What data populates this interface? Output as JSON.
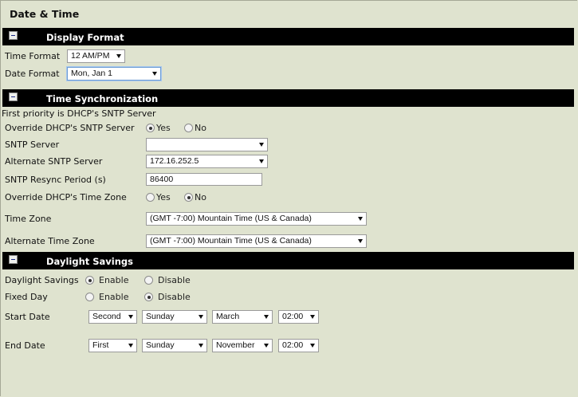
{
  "page_title": "Date & Time",
  "display_format": {
    "header": "Display Format",
    "time_format_label": "Time Format",
    "time_format_value": "12 AM/PM",
    "date_format_label": "Date Format",
    "date_format_value": "Mon, Jan 1"
  },
  "time_sync": {
    "header": "Time Synchronization",
    "note": "First priority is DHCP's SNTP Server",
    "override_sntp_label": "Override DHCP's SNTP Server",
    "override_sntp_yes": "Yes",
    "override_sntp_no": "No",
    "override_sntp_selected": "Yes",
    "sntp_server_label": "SNTP Server",
    "sntp_server_value": "",
    "alt_sntp_label": "Alternate SNTP Server",
    "alt_sntp_value": "172.16.252.5",
    "resync_label": "SNTP Resync Period (s)",
    "resync_value": "86400",
    "override_tz_label": "Override DHCP's Time Zone",
    "override_tz_yes": "Yes",
    "override_tz_no": "No",
    "override_tz_selected": "No",
    "time_zone_label": "Time Zone",
    "time_zone_value": "(GMT -7:00) Mountain Time (US & Canada)",
    "alt_time_zone_label": "Alternate Time Zone",
    "alt_time_zone_value": "(GMT -7:00) Mountain Time (US & Canada)"
  },
  "daylight": {
    "header": "Daylight Savings",
    "ds_label": "Daylight Savings",
    "ds_enable": "Enable",
    "ds_disable": "Disable",
    "ds_selected": "Enable",
    "fixed_label": "Fixed Day",
    "fixed_enable": "Enable",
    "fixed_disable": "Disable",
    "fixed_selected": "Disable",
    "start_label": "Start Date",
    "start_week": "Second",
    "start_day": "Sunday",
    "start_month": "March",
    "start_time": "02:00",
    "end_label": "End Date",
    "end_week": "First",
    "end_day": "Sunday",
    "end_month": "November",
    "end_time": "02:00"
  }
}
